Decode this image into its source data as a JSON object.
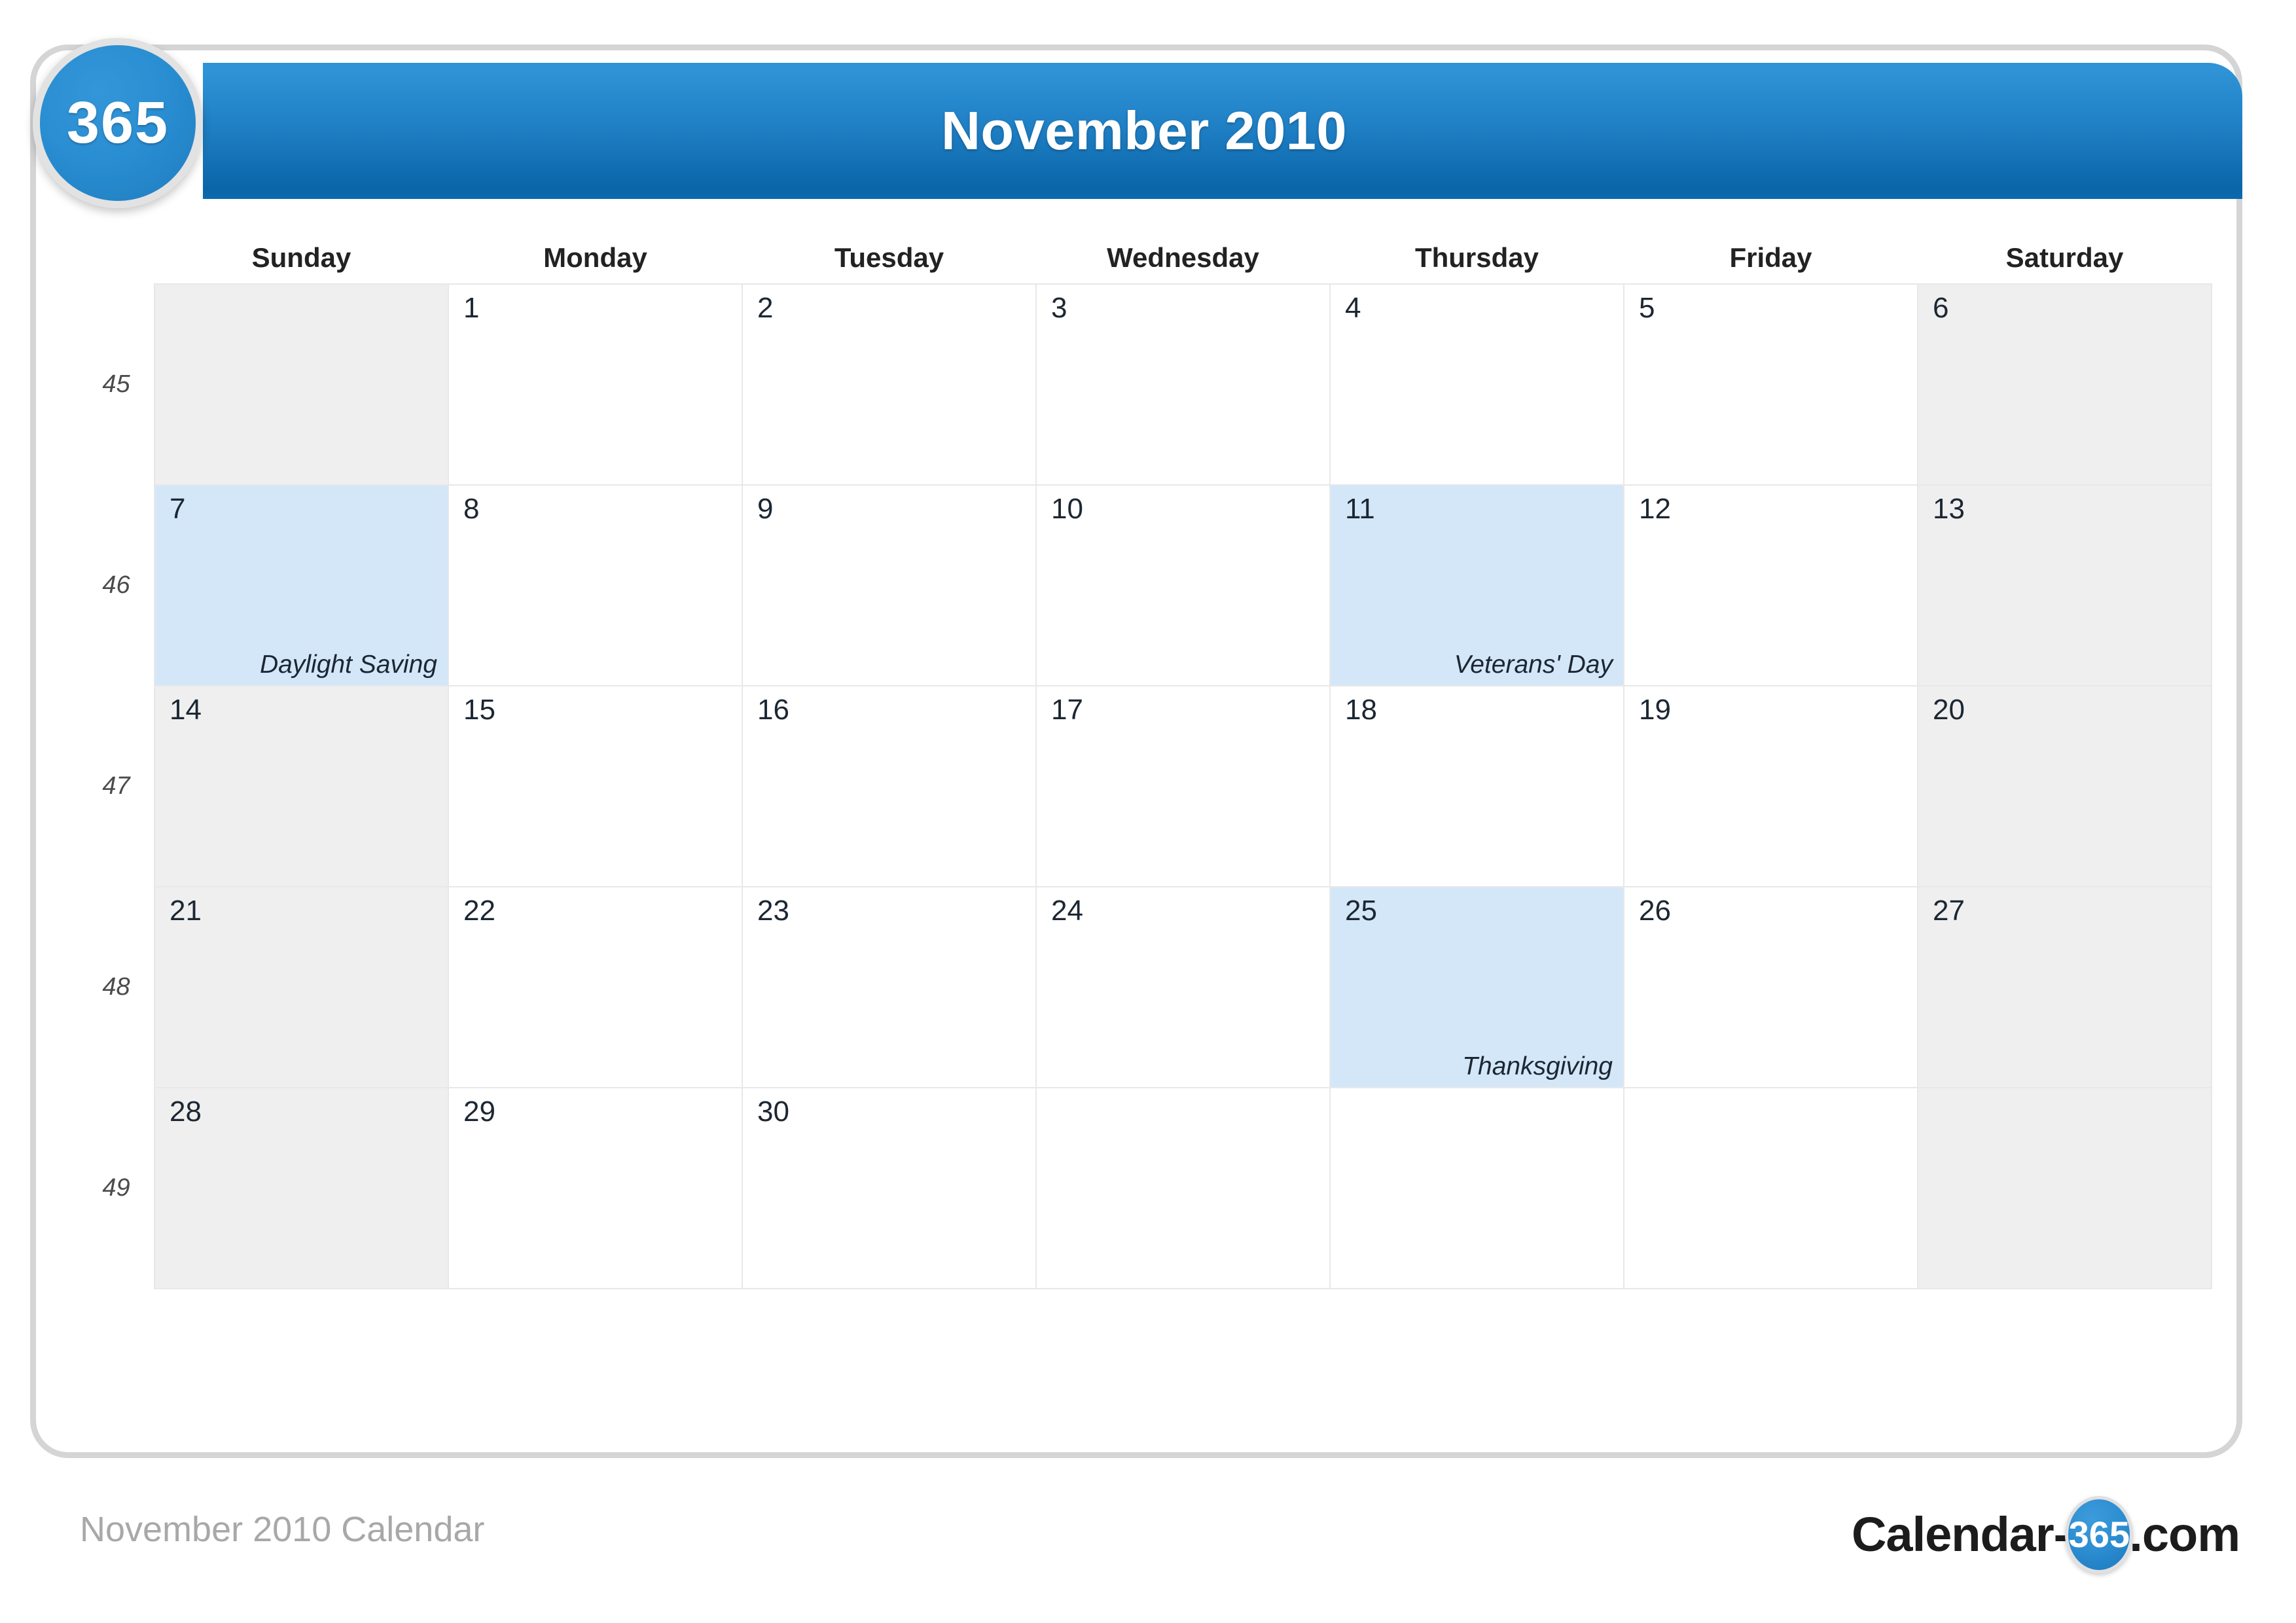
{
  "brand": {
    "badge_text": "365",
    "logo_prefix": "Calendar-",
    "logo_badge": "365",
    "logo_suffix": ".com",
    "watermark_text": "365"
  },
  "header": {
    "title": "November 2010",
    "bg_color_top": "#2f93d6",
    "bg_color_bottom": "#0a65a8"
  },
  "colors": {
    "accent": "#1f7cc0",
    "weekend_bg": "#efefef",
    "holiday_bg": "#d4e7f9",
    "grid_line": "#e8e8e8",
    "frame_border": "#d5d5d5",
    "footer_text": "#a8a8a8"
  },
  "calendar": {
    "month": "November",
    "year": "2010",
    "week_number_header": "",
    "day_headers": [
      "Sunday",
      "Monday",
      "Tuesday",
      "Wednesday",
      "Thursday",
      "Friday",
      "Saturday"
    ],
    "weeks": [
      {
        "week_number": "45",
        "days": [
          {
            "date": "",
            "event": "",
            "state": "empty-weekend"
          },
          {
            "date": "1",
            "event": "",
            "state": "normal"
          },
          {
            "date": "2",
            "event": "",
            "state": "normal"
          },
          {
            "date": "3",
            "event": "",
            "state": "normal"
          },
          {
            "date": "4",
            "event": "",
            "state": "normal"
          },
          {
            "date": "5",
            "event": "",
            "state": "normal"
          },
          {
            "date": "6",
            "event": "",
            "state": "weekend"
          }
        ]
      },
      {
        "week_number": "46",
        "days": [
          {
            "date": "7",
            "event": "Daylight Saving",
            "state": "holiday"
          },
          {
            "date": "8",
            "event": "",
            "state": "normal"
          },
          {
            "date": "9",
            "event": "",
            "state": "normal"
          },
          {
            "date": "10",
            "event": "",
            "state": "normal"
          },
          {
            "date": "11",
            "event": "Veterans' Day",
            "state": "holiday"
          },
          {
            "date": "12",
            "event": "",
            "state": "normal"
          },
          {
            "date": "13",
            "event": "",
            "state": "weekend"
          }
        ]
      },
      {
        "week_number": "47",
        "days": [
          {
            "date": "14",
            "event": "",
            "state": "weekend"
          },
          {
            "date": "15",
            "event": "",
            "state": "normal"
          },
          {
            "date": "16",
            "event": "",
            "state": "normal"
          },
          {
            "date": "17",
            "event": "",
            "state": "normal"
          },
          {
            "date": "18",
            "event": "",
            "state": "normal"
          },
          {
            "date": "19",
            "event": "",
            "state": "normal"
          },
          {
            "date": "20",
            "event": "",
            "state": "weekend"
          }
        ]
      },
      {
        "week_number": "48",
        "days": [
          {
            "date": "21",
            "event": "",
            "state": "weekend"
          },
          {
            "date": "22",
            "event": "",
            "state": "normal"
          },
          {
            "date": "23",
            "event": "",
            "state": "normal"
          },
          {
            "date": "24",
            "event": "",
            "state": "normal"
          },
          {
            "date": "25",
            "event": "Thanksgiving",
            "state": "holiday"
          },
          {
            "date": "26",
            "event": "",
            "state": "normal"
          },
          {
            "date": "27",
            "event": "",
            "state": "weekend"
          }
        ]
      },
      {
        "week_number": "49",
        "days": [
          {
            "date": "28",
            "event": "",
            "state": "weekend"
          },
          {
            "date": "29",
            "event": "",
            "state": "normal"
          },
          {
            "date": "30",
            "event": "",
            "state": "normal"
          },
          {
            "date": "",
            "event": "",
            "state": "empty"
          },
          {
            "date": "",
            "event": "",
            "state": "empty"
          },
          {
            "date": "",
            "event": "",
            "state": "empty"
          },
          {
            "date": "",
            "event": "",
            "state": "empty-weekend"
          }
        ]
      }
    ]
  },
  "footer": {
    "caption": "November 2010 Calendar"
  }
}
